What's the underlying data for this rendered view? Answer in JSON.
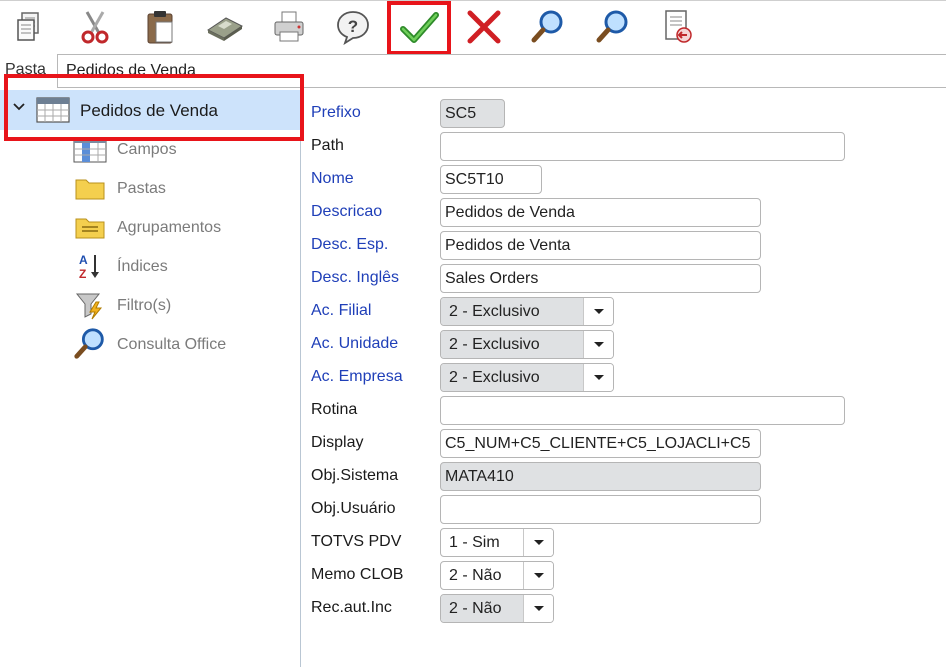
{
  "toolbar": {
    "buttons": [
      {
        "name": "copy-button",
        "icon": "copy-icon"
      },
      {
        "name": "cut-button",
        "icon": "scissors-icon"
      },
      {
        "name": "paste-button",
        "icon": "clipboard-icon"
      },
      {
        "name": "calculator-button",
        "icon": "calculator-icon"
      },
      {
        "name": "print-button",
        "icon": "printer-icon"
      },
      {
        "name": "help-button",
        "icon": "question-icon"
      },
      {
        "name": "confirm-button",
        "icon": "checkmark-icon"
      },
      {
        "name": "cancel-button",
        "icon": "x-icon"
      },
      {
        "name": "search-button",
        "icon": "magnifier-icon"
      },
      {
        "name": "search-next-button",
        "icon": "magnifier-icon"
      },
      {
        "name": "exit-button",
        "icon": "document-exit-icon"
      }
    ],
    "highlight_color": "#e8141a"
  },
  "pasta": {
    "label": "Pasta",
    "value": "Pedidos de Venda"
  },
  "tree": {
    "root": {
      "label": "Pedidos de Venda",
      "icon": "table-icon"
    },
    "children": [
      {
        "label": "Campos",
        "icon": "table-columns-icon"
      },
      {
        "label": "Pastas",
        "icon": "folder-icon"
      },
      {
        "label": "Agrupamentos",
        "icon": "folder-lines-icon"
      },
      {
        "label": "Índices",
        "icon": "sort-az-icon"
      },
      {
        "label": "Filtro(s)",
        "icon": "filter-icon"
      },
      {
        "label": "Consulta Office",
        "icon": "magnifier-icon"
      }
    ]
  },
  "form": {
    "prefixo": {
      "label": "Prefixo",
      "value": "SC5"
    },
    "path": {
      "label": "Path",
      "value": ""
    },
    "nome": {
      "label": "Nome",
      "value": "SC5T10"
    },
    "descricao": {
      "label": "Descricao",
      "value": "Pedidos de Venda"
    },
    "desc_esp": {
      "label": "Desc. Esp.",
      "value": "Pedidos de Venta"
    },
    "desc_ingles": {
      "label": "Desc. Inglês",
      "value": "Sales Orders"
    },
    "ac_filial": {
      "label": "Ac. Filial",
      "value": "2 - Exclusivo"
    },
    "ac_unidade": {
      "label": "Ac. Unidade",
      "value": "2 - Exclusivo"
    },
    "ac_empresa": {
      "label": "Ac. Empresa",
      "value": "2 - Exclusivo"
    },
    "rotina": {
      "label": "Rotina",
      "value": ""
    },
    "display": {
      "label": "Display",
      "value": "C5_NUM+C5_CLIENTE+C5_LOJACLI+C5"
    },
    "obj_sistema": {
      "label": "Obj.Sistema",
      "value": "MATA410"
    },
    "obj_usuario": {
      "label": "Obj.Usuário",
      "value": ""
    },
    "totvs_pdv": {
      "label": "TOTVS PDV",
      "value": "1 - Sim"
    },
    "memo_clob": {
      "label": "Memo CLOB",
      "value": "2 - Não"
    },
    "rec_aut_inc": {
      "label": "Rec.aut.Inc",
      "value": "2 - Não"
    }
  }
}
